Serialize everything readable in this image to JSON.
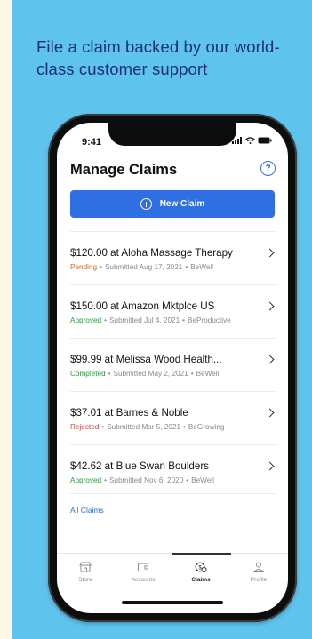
{
  "headline": "File a claim backed by our world-class customer support",
  "status_bar": {
    "time": "9:41"
  },
  "page": {
    "title": "Manage Claims",
    "help_icon": "?",
    "new_claim_label": "New Claim",
    "all_claims_label": "All Claims"
  },
  "claims": [
    {
      "title": "$120.00 at Aloha Massage Therapy",
      "status": "Pending",
      "status_color": "#d46b18",
      "submitted": "Submitted Aug 17, 2021",
      "account": "BeWell"
    },
    {
      "title": "$150.00 at Amazon Mktplce US",
      "status": "Approved",
      "status_color": "#2a9d3c",
      "submitted": "Submitted Jul 4, 2021",
      "account": "BeProductive"
    },
    {
      "title": "$99.99 at Melissa Wood Health...",
      "status": "Completed",
      "status_color": "#2a9d3c",
      "submitted": "Submitted May 2, 2021",
      "account": "BeWell"
    },
    {
      "title": "$37.01 at Barnes & Noble",
      "status": "Rejected",
      "status_color": "#e03b3b",
      "submitted": "Submitted Mar 5, 2021",
      "account": "BeGrowing"
    },
    {
      "title": "$42.62 at Blue Swan Boulders",
      "status": "Approved",
      "status_color": "#2a9d3c",
      "submitted": "Submitted Nov 6, 2020",
      "account": "BeWell"
    }
  ],
  "tabs": [
    {
      "label": "Store",
      "icon": "store-icon"
    },
    {
      "label": "Accounts",
      "icon": "wallet-icon"
    },
    {
      "label": "Claims",
      "icon": "claims-icon",
      "active": true
    },
    {
      "label": "Profile",
      "icon": "profile-icon"
    }
  ],
  "colors": {
    "panel_bg": "#5ec4ee",
    "headline": "#1b2f78",
    "accent": "#2f6fe4"
  }
}
